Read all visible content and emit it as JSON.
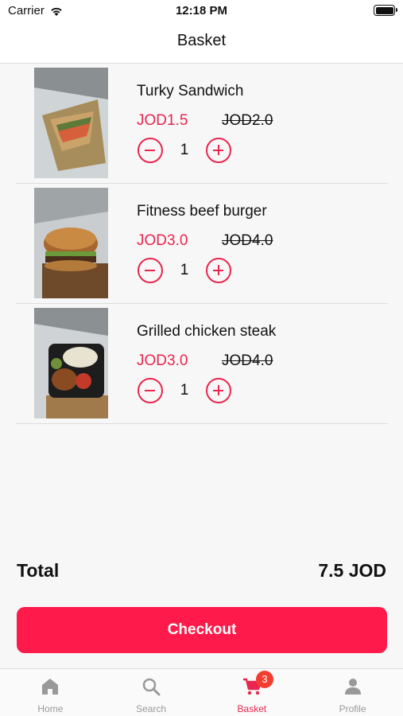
{
  "status_bar": {
    "carrier": "Carrier",
    "time": "12:18 PM"
  },
  "header": {
    "title": "Basket"
  },
  "items": [
    {
      "name": "Turky Sandwich",
      "price": "JOD1.5",
      "old_price": "JOD2.0",
      "quantity": "1"
    },
    {
      "name": "Fitness beef burger",
      "price": "JOD3.0",
      "old_price": "JOD4.0",
      "quantity": "1"
    },
    {
      "name": "Grilled chicken steak",
      "price": "JOD3.0",
      "old_price": "JOD4.0",
      "quantity": "1"
    }
  ],
  "summary": {
    "total_label": "Total",
    "total_value": "7.5 JOD"
  },
  "checkout_label": "Checkout",
  "tabs": [
    {
      "label": "Home",
      "icon": "home-icon"
    },
    {
      "label": "Search",
      "icon": "search-icon"
    },
    {
      "label": "Basket",
      "icon": "cart-icon",
      "badge": "3"
    },
    {
      "label": "Profile",
      "icon": "person-icon"
    }
  ],
  "colors": {
    "accent": "#e8264f",
    "button": "#fe1a4a",
    "badge": "#f23d2f",
    "inactive_tab": "#999999"
  }
}
